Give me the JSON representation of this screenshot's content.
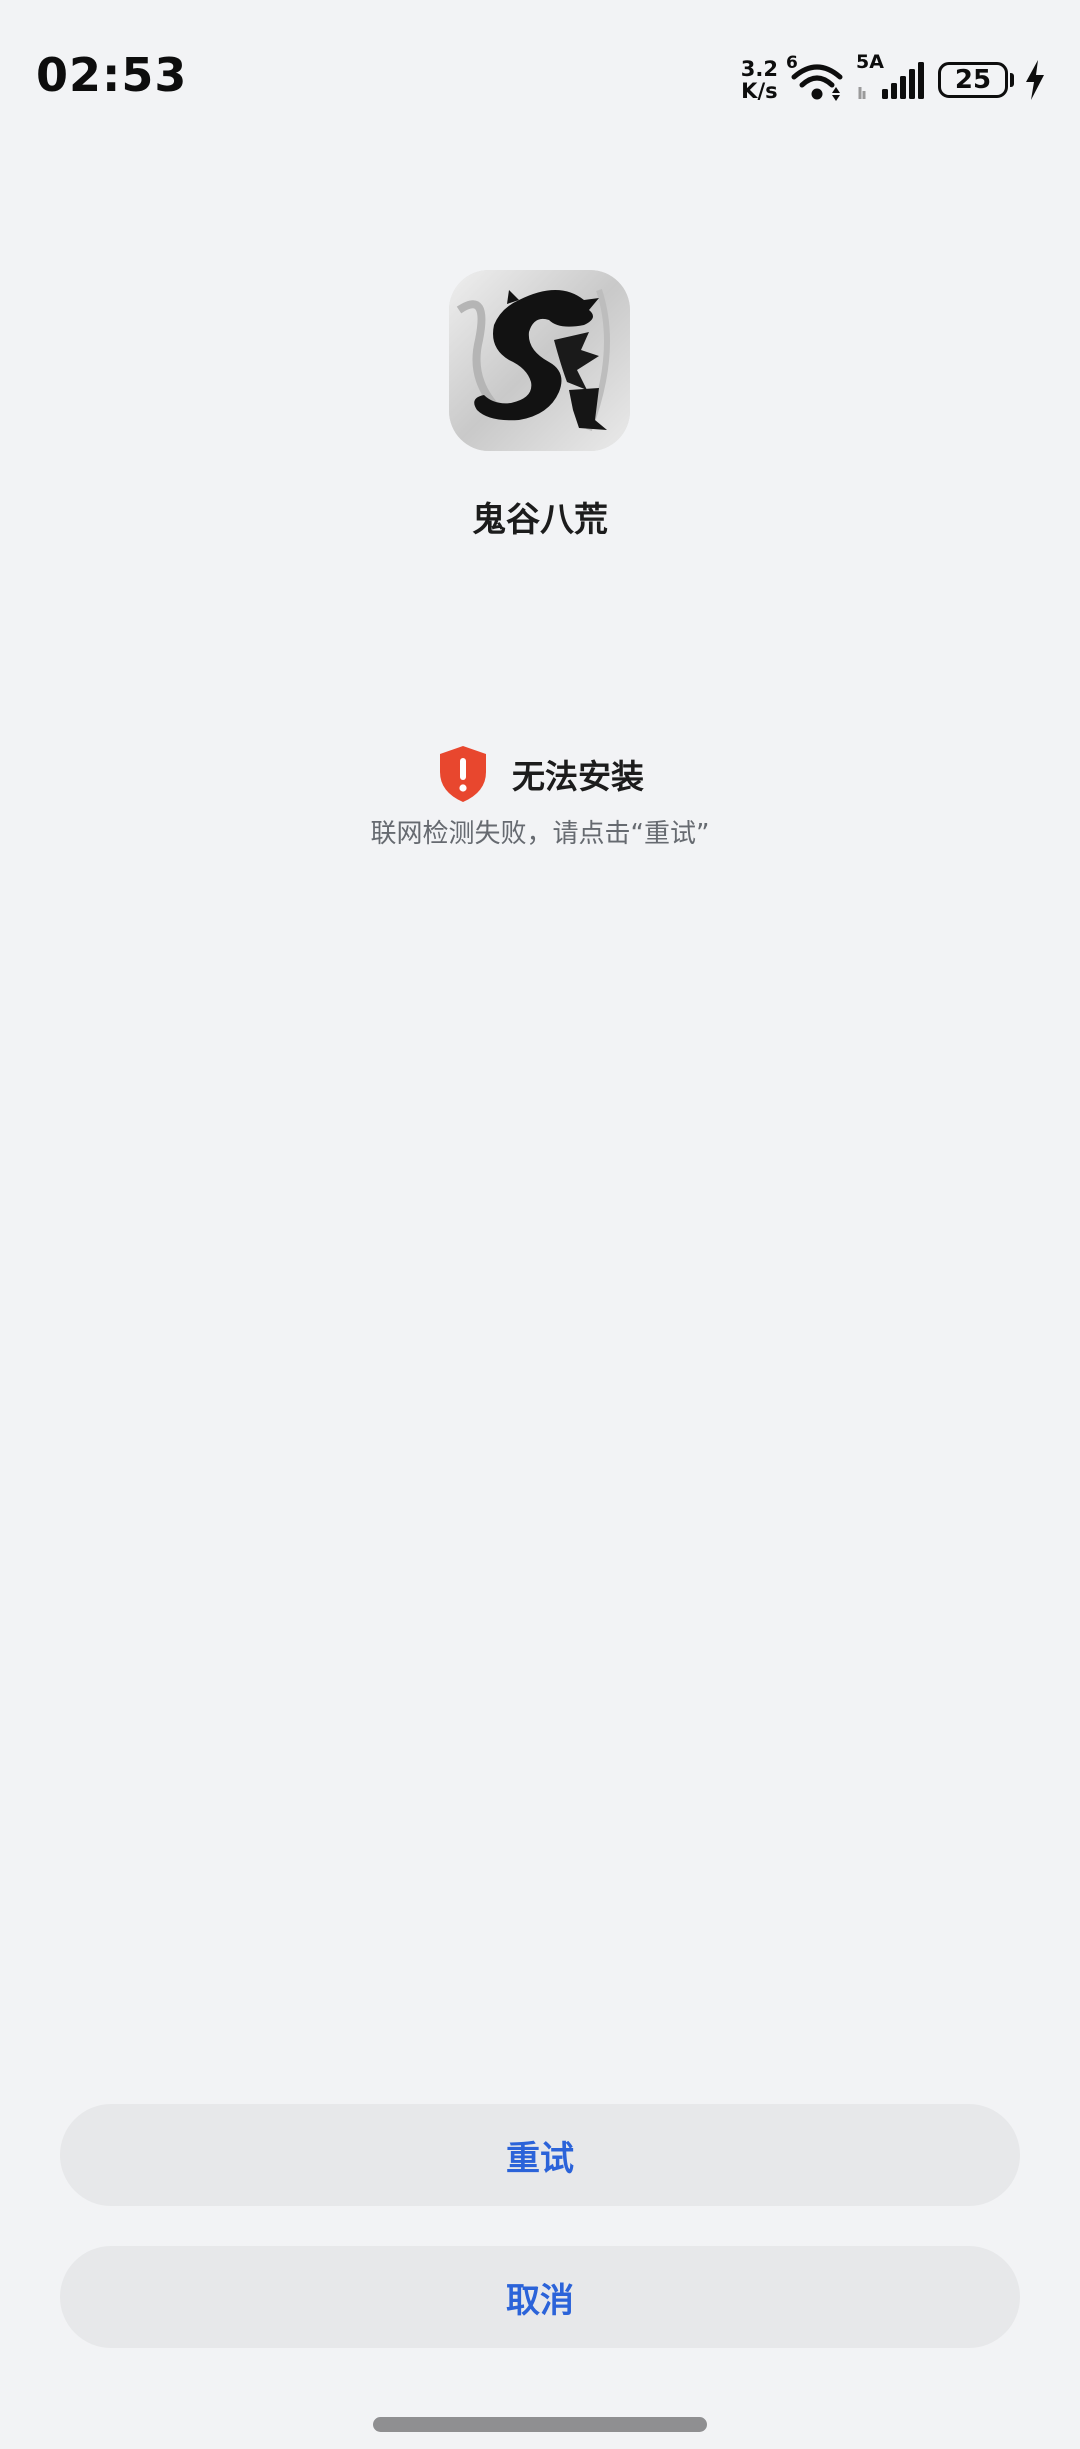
{
  "status_bar": {
    "time": "02:53",
    "net_speed_value": "3.2",
    "net_speed_unit": "K/s",
    "wifi_label": "6",
    "signal_label": "5A",
    "battery_level": "25"
  },
  "app": {
    "name": "鬼谷八荒",
    "icon": "dragon-logo-icon"
  },
  "status": {
    "title": "无法安装",
    "description": "联网检测失败，请点击“重试”",
    "icon": "warning-shield-icon",
    "icon_color": "#e8472e"
  },
  "buttons": {
    "retry": "重试",
    "cancel": "取消"
  },
  "colors": {
    "accent": "#2b63d9",
    "background": "#f2f3f5",
    "button_bg": "#e7e8ea"
  }
}
